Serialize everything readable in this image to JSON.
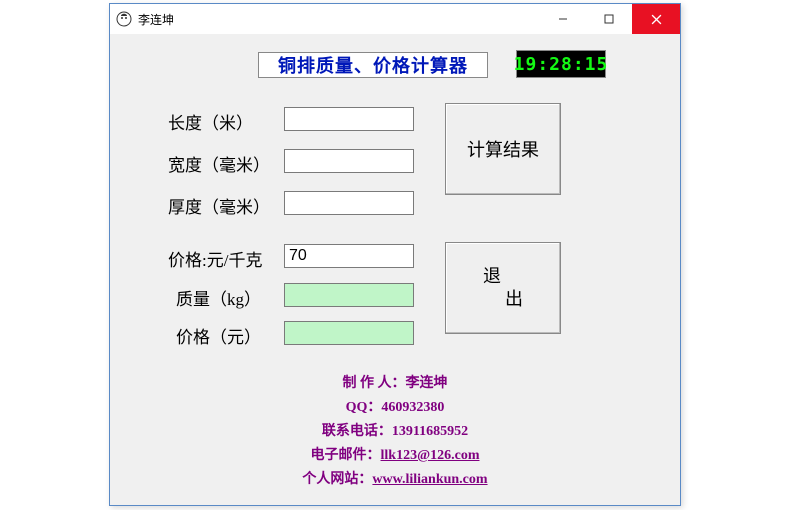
{
  "window": {
    "title": "李连坤"
  },
  "header": {
    "title": "铜排质量、价格计算器",
    "clock": "19:28:15"
  },
  "labels": {
    "length": "长度（米）",
    "width": "宽度（毫米）",
    "thickness": "厚度（毫米）",
    "price_per_kg": "价格:元/千克",
    "mass": "质量（kg）",
    "price": "价格（元）"
  },
  "inputs": {
    "length": "",
    "width": "",
    "thickness": "",
    "price_per_kg": "70",
    "mass": "",
    "price": ""
  },
  "buttons": {
    "calc": "计算结果",
    "exit_l1": "退",
    "exit_l2": "出"
  },
  "credits": {
    "author": "制 作 人：李连坤",
    "qq": "QQ：460932380",
    "phone": "联系电话：13911685952",
    "email_label": "电子邮件：",
    "email": "llk123@126.com",
    "site_label": "个人网站：",
    "site": "www.liliankun.com"
  }
}
